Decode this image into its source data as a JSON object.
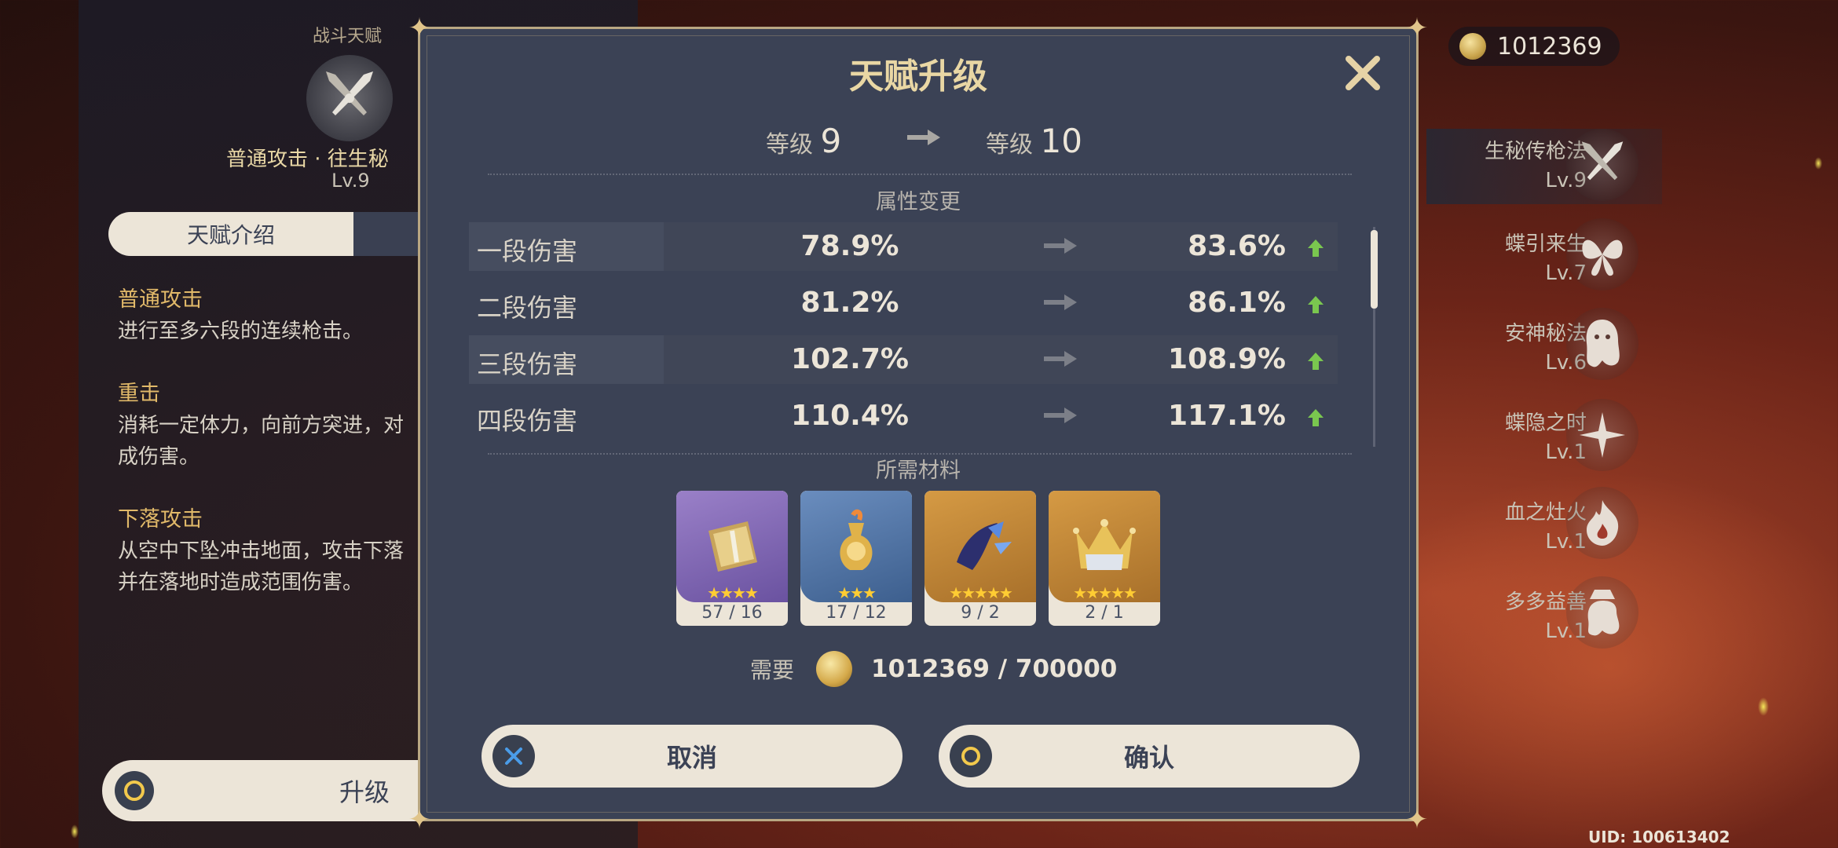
{
  "currency": {
    "amount": "1012369"
  },
  "left_panel": {
    "section_title": "战斗天赋",
    "talent_name": "普通攻击 · 往生秘",
    "talent_level": "Lv.9",
    "tab_label": "天赋介绍",
    "descriptions": [
      {
        "heading": "普通攻击",
        "text": "进行至多六段的连续枪击。"
      },
      {
        "heading": "重击",
        "text": "消耗一定体力，向前方突进，对",
        "text2": "成伤害。"
      },
      {
        "heading": "下落攻击",
        "text": "从空中下坠冲击地面，攻击下落",
        "text2": "并在落地时造成范围伤害。"
      }
    ],
    "upgrade_label": "升级"
  },
  "talent_list": [
    {
      "name": "生秘传枪法",
      "level": "Lv.9",
      "icon": "spear-icon"
    },
    {
      "name": "蝶引来生",
      "level": "Lv.7",
      "icon": "butterfly-icon"
    },
    {
      "name": "安神秘法",
      "level": "Lv.6",
      "icon": "ghost-icon"
    },
    {
      "name": "蝶隐之时",
      "level": "Lv.1",
      "icon": "shuriken-icon"
    },
    {
      "name": "血之灶火",
      "level": "Lv.1",
      "icon": "flame-icon"
    },
    {
      "name": "多多益善",
      "level": "Lv.1",
      "icon": "ghost-hat-icon"
    }
  ],
  "uid": "UID: 100613402",
  "modal": {
    "title": "天赋升级",
    "from_label": "等级",
    "from_value": "9",
    "to_label": "等级",
    "to_value": "10",
    "attr_section": "属性变更",
    "attributes": [
      {
        "name": "一段伤害",
        "current": "78.9%",
        "next": "83.6%"
      },
      {
        "name": "二段伤害",
        "current": "81.2%",
        "next": "86.1%"
      },
      {
        "name": "三段伤害",
        "current": "102.7%",
        "next": "108.9%"
      },
      {
        "name": "四段伤害",
        "current": "110.4%",
        "next": "117.1%"
      }
    ],
    "materials_section": "所需材料",
    "materials": [
      {
        "count": "57 / 16",
        "stars": "★★★★",
        "rarity_color": "#8a6fb8"
      },
      {
        "count": "17 / 12",
        "stars": "★★★",
        "rarity_color": "#4f73a6"
      },
      {
        "count": "9 / 2",
        "stars": "★★★★★",
        "rarity_color": "#c18a3c"
      },
      {
        "count": "2 / 1",
        "stars": "★★★★★",
        "rarity_color": "#c18a3c"
      }
    ],
    "need_label": "需要",
    "need_value": "1012369 / 700000",
    "cancel_label": "取消",
    "confirm_label": "确认"
  }
}
